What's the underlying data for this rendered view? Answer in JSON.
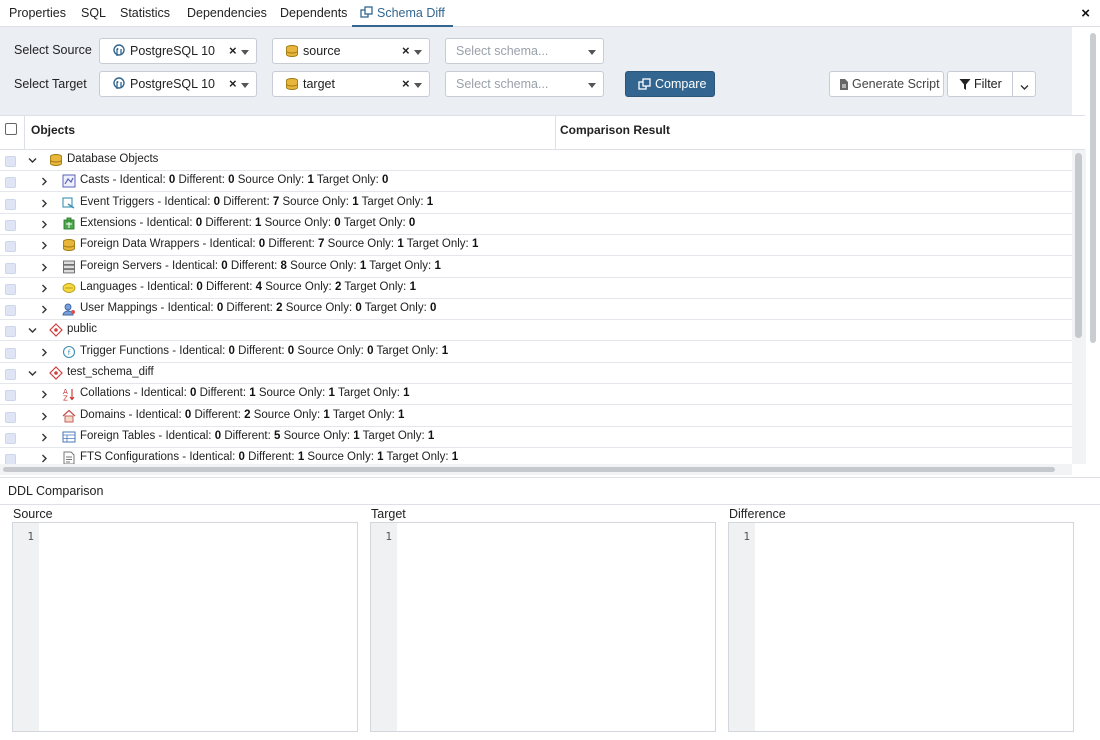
{
  "tabs": [
    {
      "label": "Properties"
    },
    {
      "label": "SQL"
    },
    {
      "label": "Statistics"
    },
    {
      "label": "Dependencies"
    },
    {
      "label": "Dependents"
    },
    {
      "label": "Schema Diff"
    }
  ],
  "close_label": "×",
  "source": {
    "label": "Select Source",
    "server": "PostgreSQL 10",
    "database": "source",
    "schema_placeholder": "Select schema..."
  },
  "target": {
    "label": "Select Target",
    "server": "PostgreSQL 10",
    "database": "target",
    "schema_placeholder": "Select schema..."
  },
  "clear_glyph": "×",
  "buttons": {
    "compare": "Compare",
    "generate_script": "Generate Script",
    "filter": "Filter"
  },
  "grid": {
    "col_objects": "Objects",
    "col_result": "Comparison Result"
  },
  "rows": [
    {
      "type": "group",
      "label": "Database Objects",
      "icon": "database-icon"
    },
    {
      "type": "item",
      "name": "Casts",
      "icon": "cast-icon",
      "identical": "0",
      "different": "0",
      "source_only": "1",
      "target_only": "0"
    },
    {
      "type": "item",
      "name": "Event Triggers",
      "icon": "event-trigger-icon",
      "identical": "0",
      "different": "7",
      "source_only": "1",
      "target_only": "1"
    },
    {
      "type": "item",
      "name": "Extensions",
      "icon": "extension-icon",
      "identical": "0",
      "different": "1",
      "source_only": "0",
      "target_only": "0"
    },
    {
      "type": "item",
      "name": "Foreign Data Wrappers",
      "icon": "foreign-data-wrapper-icon",
      "identical": "0",
      "different": "7",
      "source_only": "1",
      "target_only": "1"
    },
    {
      "type": "item",
      "name": "Foreign Servers",
      "icon": "foreign-server-icon",
      "identical": "0",
      "different": "8",
      "source_only": "1",
      "target_only": "1"
    },
    {
      "type": "item",
      "name": "Languages",
      "icon": "language-icon",
      "identical": "0",
      "different": "4",
      "source_only": "2",
      "target_only": "1"
    },
    {
      "type": "item",
      "name": "User Mappings",
      "icon": "user-mapping-icon",
      "identical": "0",
      "different": "2",
      "source_only": "0",
      "target_only": "0"
    },
    {
      "type": "group",
      "label": "public",
      "icon": "schema-icon"
    },
    {
      "type": "item",
      "name": "Trigger Functions",
      "icon": "trigger-function-icon",
      "identical": "0",
      "different": "0",
      "source_only": "0",
      "target_only": "1"
    },
    {
      "type": "group",
      "label": "test_schema_diff",
      "icon": "schema-icon"
    },
    {
      "type": "item",
      "name": "Collations",
      "icon": "collation-icon",
      "identical": "0",
      "different": "1",
      "source_only": "1",
      "target_only": "1"
    },
    {
      "type": "item",
      "name": "Domains",
      "icon": "domain-icon",
      "identical": "0",
      "different": "2",
      "source_only": "1",
      "target_only": "1"
    },
    {
      "type": "item",
      "name": "Foreign Tables",
      "icon": "foreign-table-icon",
      "identical": "0",
      "different": "5",
      "source_only": "1",
      "target_only": "1"
    },
    {
      "type": "item",
      "name": "FTS Configurations",
      "icon": "fts-configuration-icon",
      "identical": "0",
      "different": "1",
      "source_only": "1",
      "target_only": "1"
    }
  ],
  "stat_labels": {
    "identical": "Identical:",
    "different": "Different:",
    "source_only": "Source Only:",
    "target_only": "Target Only:"
  },
  "ddl": {
    "title": "DDL Comparison",
    "source_label": "Source",
    "target_label": "Target",
    "difference_label": "Difference",
    "line_number": "1"
  },
  "colors": {
    "accent": "#326690",
    "toolbar_bg": "#ebeef3"
  }
}
